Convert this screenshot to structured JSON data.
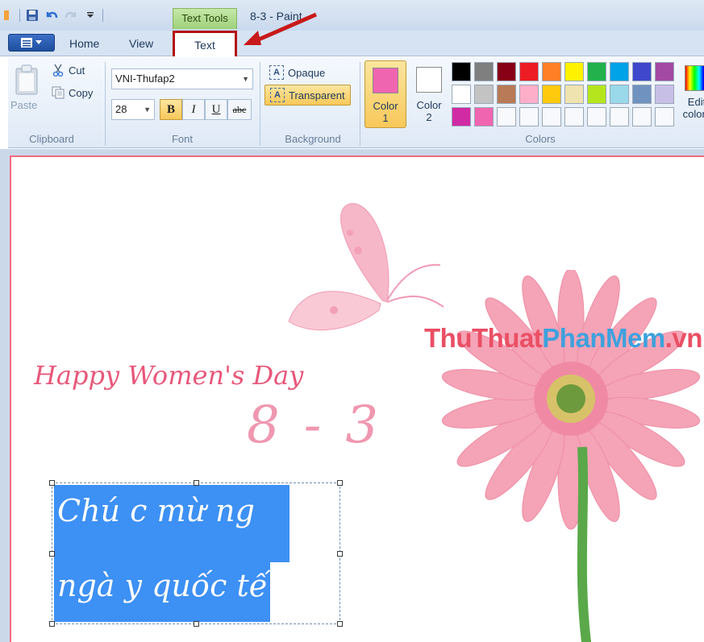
{
  "window": {
    "title": "8-3 - Paint"
  },
  "context_tab": {
    "label": "Text Tools"
  },
  "tabs": {
    "home": "Home",
    "view": "View",
    "text": "Text"
  },
  "clipboard": {
    "paste": "Paste",
    "cut": "Cut",
    "copy": "Copy",
    "group": "Clipboard"
  },
  "font": {
    "name": "VNI-Thufap2",
    "size": "28",
    "bold": "B",
    "italic": "I",
    "underline": "U",
    "strike": "abc",
    "group": "Font"
  },
  "background": {
    "opaque": "Opaque",
    "transparent": "Transparent",
    "group": "Background"
  },
  "colors": {
    "color1_label": "Color",
    "color1_num": "1",
    "color1_value": "#f065b0",
    "color2_label": "Color",
    "color2_num": "2",
    "color2_value": "#ffffff",
    "group": "Colors",
    "edit_label": "Edit",
    "edit_label2": "colors",
    "palette_row1": [
      "#000000",
      "#7f7f7f",
      "#880015",
      "#ed1c24",
      "#ff7f27",
      "#fff200",
      "#22b14c",
      "#00a2e8",
      "#3f48cc",
      "#a349a4"
    ],
    "palette_row2": [
      "#ffffff",
      "#c3c3c3",
      "#b97a57",
      "#ffaec9",
      "#ffc90e",
      "#efe4b0",
      "#b5e61d",
      "#99d9ea",
      "#7092be",
      "#c8bfe7"
    ],
    "palette_row3": [
      "#d02aa5",
      "#f065b0",
      "",
      "",
      "",
      "",
      "",
      "",
      "",
      ""
    ]
  },
  "canvas": {
    "watermark": {
      "part1": "ThuThuat",
      "part2": "PhanMem",
      "part3": ".vn"
    },
    "greeting": "Happy Women's Day",
    "date": "8-3",
    "textbox_line1": "Chú c mừ ng",
    "textbox_line2": "ngà y quốc tế"
  }
}
